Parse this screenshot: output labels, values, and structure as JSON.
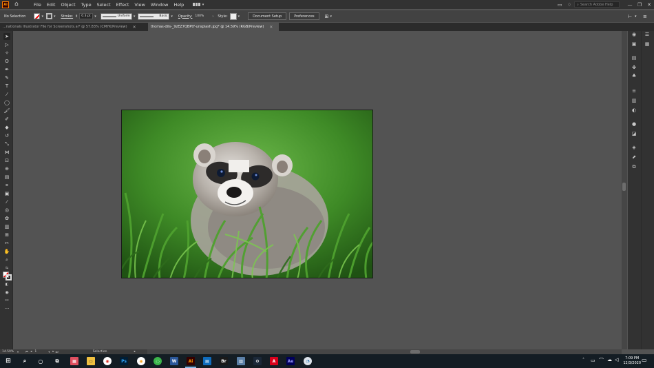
{
  "app": {
    "logo": "Ai"
  },
  "menubar": {
    "items": [
      "File",
      "Edit",
      "Object",
      "Type",
      "Select",
      "Effect",
      "View",
      "Window",
      "Help"
    ],
    "search_placeholder": "Search Adobe Help"
  },
  "controlbar": {
    "selection_state": "No Selection",
    "stroke_label": "Stroke:",
    "stroke_weight": "0.3 pt",
    "stroke_profile": "Uniform",
    "brush": "Basic",
    "opacity_label": "Opacity:",
    "opacity_value": "100%",
    "style_label": "Style:",
    "document_setup": "Document Setup",
    "preferences": "Preferences"
  },
  "tabs": [
    {
      "label": "...nationals Illustrator File for Screenshots.ai* @ 57.83% (CMYK/Preview)",
      "active": false
    },
    {
      "label": "thomas-dils-_9zEZ7QBPtY-unsplash.jpg* @ 14.59% (RGB/Preview)",
      "active": true
    }
  ],
  "statusbar": {
    "zoom": "14.59%",
    "artboard_number": "1",
    "tool_name": "Selection"
  },
  "taskbar": {
    "time": "7:09 PM",
    "date": "12/3/2020"
  },
  "icons": {
    "home": "home-icon",
    "lightbulb": "lightbulb-icon",
    "search": "search-icon",
    "windows": "windows-start-icon"
  }
}
